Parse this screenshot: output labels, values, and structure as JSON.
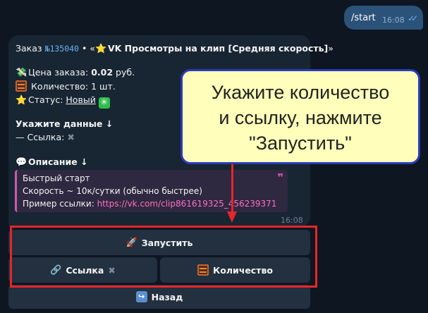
{
  "outgoing": {
    "text": "/start",
    "time": "16:08"
  },
  "message": {
    "order_prefix": "Заказ ",
    "order_id": "№135040",
    "order_mid": " • «",
    "service_name": "VK Просмотры на клип [Средняя скорость]",
    "order_end": "»",
    "price_label": "Цена заказа: ",
    "price_value": "0.02",
    "price_unit": " руб.",
    "quantity_label": "Количество: ",
    "quantity_value": "1 шт.",
    "status_label": "Статус: ",
    "status_value": "Новый",
    "data_heading": "Укажите данные ↓",
    "link_label": "— Ссылка: ",
    "desc_heading": "Описание ↓",
    "desc_line1": "Быстрый старт",
    "desc_line2": "Скорость ~ 10к/сутки (обычно быстрее)",
    "desc_line3_label": "Пример ссылки: ",
    "desc_line3_link": "https://vk.com/clip861619325_456239371",
    "quote_mark": "❞",
    "time": "16:08"
  },
  "keyboard": {
    "start_label": "Запустить",
    "link_label": "Ссылка",
    "quantity_label": "Количество",
    "back_label": "Назад"
  },
  "callout": {
    "line1": "Укажите количество",
    "line2": "и ссылку, нажмите",
    "line3": "\"Запустить\""
  },
  "icons": {
    "price": "money-icon",
    "quantity": "abacus-icon",
    "status": "star-icon",
    "service": "star-icon",
    "status_new": "sparkle-icon",
    "description": "speech-bubble-icon",
    "start": "rocket-icon",
    "link": "link-icon",
    "back": "back-arrow-icon"
  },
  "colors": {
    "background": "#0e1621",
    "outgoing_bubble": "#2b5278",
    "incoming_bubble": "#182533",
    "keyboard_button": "#22303f",
    "annotation_red": "#e6262a",
    "callout_fill": "#ffffbb",
    "callout_border": "#2a3cb8"
  }
}
